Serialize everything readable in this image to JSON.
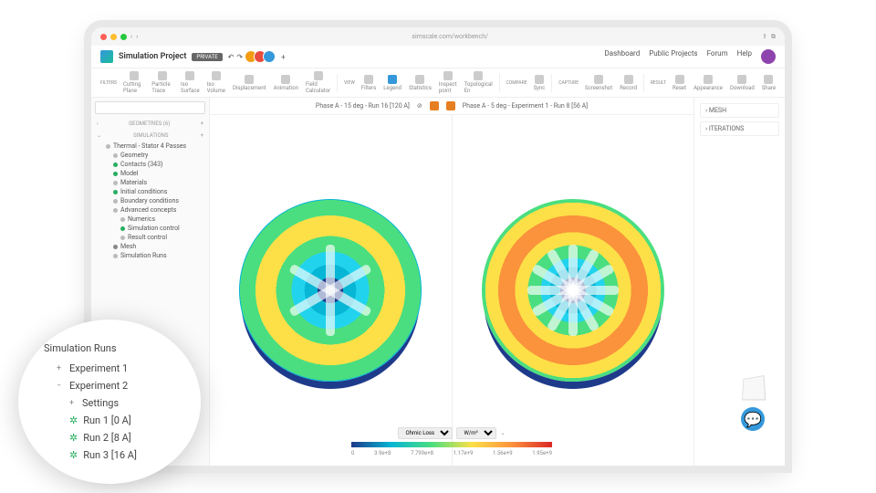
{
  "browser": {
    "url": "simscale.com/workbench/"
  },
  "header": {
    "project_name": "Simulation Project",
    "badge": "PRIVATE",
    "nav": {
      "dashboard": "Dashboard",
      "public_projects": "Public Projects",
      "forum": "Forum",
      "help": "Help"
    }
  },
  "toolbar": {
    "filters_label": "FILTERS",
    "filters": [
      "Cutting Plane",
      "Particle Trace",
      "Iso Surface",
      "Iso Volume",
      "Displacement",
      "Animation",
      "Field Calculator"
    ],
    "view_label": "VIEW",
    "view": [
      "Filters",
      "Legend",
      "Statistics",
      "Inspect point",
      "Topological En"
    ],
    "compare_label": "COMPARE",
    "compare": [
      "Sync"
    ],
    "capture_label": "CAPTURE",
    "capture": [
      "Screenshot",
      "Record"
    ],
    "result_label": "RESULT",
    "result": [
      "Reset",
      "Appearance",
      "Download",
      "Share"
    ]
  },
  "sidebar": {
    "geometries": "GEOMETRIES (6)",
    "simulations": "SIMULATIONS",
    "items": [
      {
        "label": "Thermal - Stator 4 Passes"
      },
      {
        "label": "Geometry"
      },
      {
        "label": "Contacts (343)"
      },
      {
        "label": "Model"
      },
      {
        "label": "Materials"
      },
      {
        "label": "Initial conditions"
      },
      {
        "label": "Boundary conditions"
      },
      {
        "label": "Advanced concepts"
      },
      {
        "label": "Numerics"
      },
      {
        "label": "Simulation control"
      },
      {
        "label": "Result control"
      },
      {
        "label": "Mesh"
      },
      {
        "label": "Simulation Runs"
      }
    ]
  },
  "canvas": {
    "left_title": "Phase A - 15 deg - Run 16 [120 A]",
    "right_title": "Phase A - 5 deg - Experiment 1 - Run 8 [56 A]"
  },
  "legend": {
    "field": "Ohmic Loss",
    "unit": "W/m³",
    "ticks": [
      "0",
      "3.9e+8",
      "7.799e+8",
      "1.17e+9",
      "1.56e+9",
      "1.95e+9"
    ]
  },
  "right_panel": {
    "mesh": "MESH",
    "iterations": "ITERATIONS"
  },
  "zoom": {
    "title": "Simulation Runs",
    "items": [
      {
        "label": "Experiment 1",
        "type": "folder"
      },
      {
        "label": "Experiment 2",
        "type": "folder",
        "open": true
      },
      {
        "label": "Settings",
        "type": "sub"
      },
      {
        "label": "Run 1 [0 A]",
        "type": "run"
      },
      {
        "label": "Run 2 [8 A]",
        "type": "run"
      },
      {
        "label": "Run 3 [16 A]",
        "type": "run"
      }
    ]
  }
}
